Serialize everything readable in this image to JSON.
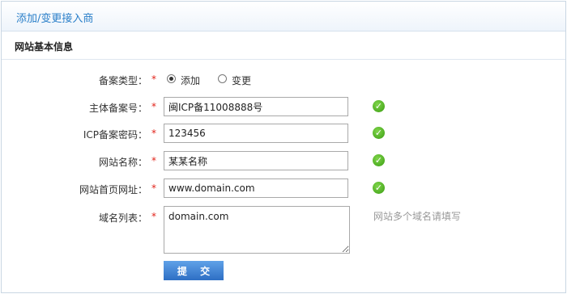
{
  "header": {
    "title": "添加/变更接入商"
  },
  "section": {
    "title": "网站基本信息"
  },
  "form": {
    "required_mark": "*",
    "filing_type": {
      "label": "备案类型：",
      "options": [
        {
          "label": "添加",
          "checked": true
        },
        {
          "label": "变更",
          "checked": false
        }
      ]
    },
    "main_filing_no": {
      "label": "主体备案号：",
      "value": "闽ICP备11008888号",
      "valid": true
    },
    "icp_password": {
      "label": "ICP备案密码：",
      "value": "123456",
      "valid": true
    },
    "site_name": {
      "label": "网站名称：",
      "value": "某某名称",
      "valid": true
    },
    "homepage_url": {
      "label": "网站首页网址：",
      "value": "www.domain.com",
      "valid": true
    },
    "domain_list": {
      "label": "域名列表：",
      "value": "domain.com",
      "hint": "网站多个域名请填写"
    },
    "submit_label": "提 交"
  },
  "icons": {
    "valid": "check-circle-icon"
  },
  "colors": {
    "accent": "#2a7fc9",
    "required": "#e2231a",
    "valid": "#3a9d12",
    "button": "#2e6fc4"
  }
}
